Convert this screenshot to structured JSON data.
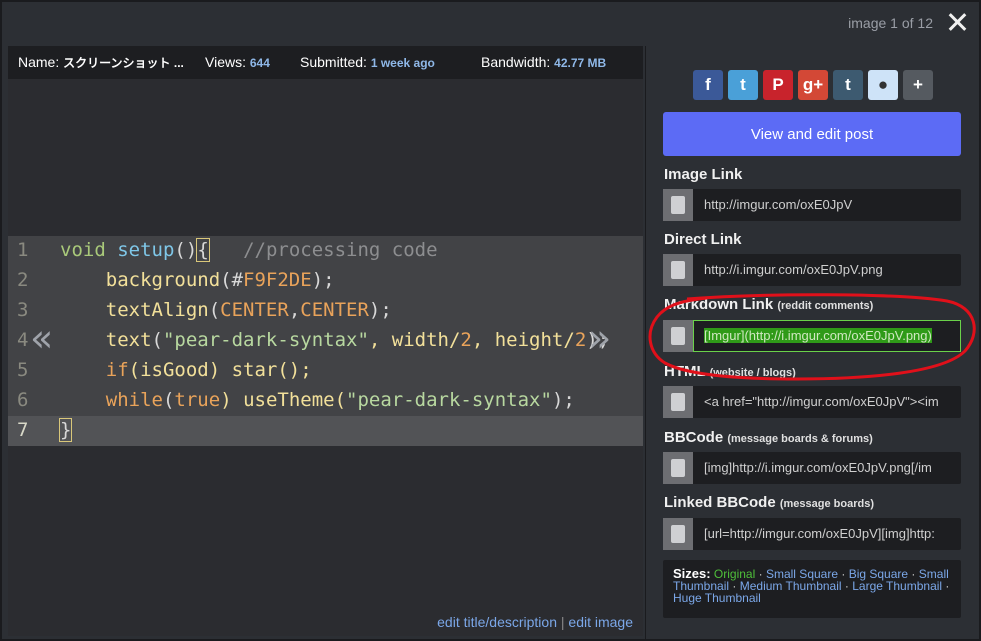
{
  "counter": "image 1 of 12",
  "info": {
    "name_label": "Name:",
    "name_value": "スクリーンショット ...",
    "views_label": "Views:",
    "views_value": "644",
    "submitted_label": "Submitted:",
    "submitted_value": "1 week ago",
    "bandwidth_label": "Bandwidth:",
    "bandwidth_value": "42.77 MB"
  },
  "code_lines": [
    {
      "n": "1"
    },
    {
      "n": "2"
    },
    {
      "n": "3"
    },
    {
      "n": "4"
    },
    {
      "n": "5"
    },
    {
      "n": "6"
    },
    {
      "n": "7"
    }
  ],
  "code": {
    "l1": [
      "void",
      " ",
      "setup",
      "()",
      "{",
      "   ",
      "//processing code"
    ],
    "l2": [
      "    ",
      "background",
      "(#",
      "F9F2DE",
      ");"
    ],
    "l3": [
      "    ",
      "textAlign",
      "(",
      "CENTER",
      ",",
      "CENTER",
      ");"
    ],
    "l4": [
      "    ",
      "text",
      "(",
      "\"pear-dark-syntax\"",
      ", width/",
      "2",
      ", height/",
      "2",
      ");"
    ],
    "l5": [
      "    ",
      "if",
      "(isGood) star();"
    ],
    "l6": [
      "    ",
      "while",
      "(",
      "true",
      ") useTheme(",
      "\"pear-dark-syntax\"",
      ");"
    ],
    "l7": [
      "}"
    ]
  },
  "nav": {
    "prev": "«",
    "next": "»"
  },
  "footer": {
    "edit_title": "edit title/description",
    "sep": "|",
    "edit_image": "edit image"
  },
  "share_icons": [
    {
      "name": "facebook-icon",
      "glyph": "f",
      "color": "#3b5998"
    },
    {
      "name": "twitter-icon",
      "glyph": "t",
      "color": "#4aa0d8"
    },
    {
      "name": "pinterest-icon",
      "glyph": "P",
      "color": "#c8232c"
    },
    {
      "name": "googleplus-icon",
      "glyph": "g+",
      "color": "#d34836"
    },
    {
      "name": "tumblr-icon",
      "glyph": "t",
      "color": "#3d5a70"
    },
    {
      "name": "reddit-icon",
      "glyph": "●",
      "color": "#cee3f8"
    },
    {
      "name": "more-icon",
      "glyph": "+",
      "color": "#555a60"
    }
  ],
  "view_edit_post": "View and edit post",
  "links": {
    "image": {
      "label": "Image Link",
      "sub": "",
      "value": "http://imgur.com/oxE0JpV"
    },
    "direct": {
      "label": "Direct Link",
      "sub": "",
      "value": "http://i.imgur.com/oxE0JpV.png"
    },
    "markdown": {
      "label": "Markdown Link",
      "sub": "(reddit comments)",
      "value": "[Imgur](http://i.imgur.com/oxE0JpV.png)"
    },
    "html": {
      "label": "HTML",
      "sub": "(website / blogs)",
      "value": "<a href=\"http://imgur.com/oxE0JpV\"><im"
    },
    "bbcode": {
      "label": "BBCode",
      "sub": "(message boards & forums)",
      "value": "[img]http://i.imgur.com/oxE0JpV.png[/im"
    },
    "linked_bbcode": {
      "label": "Linked BBCode",
      "sub": "(message boards)",
      "value": "[url=http://imgur.com/oxE0JpV][img]http:"
    }
  },
  "sizes": {
    "heading": "Sizes:",
    "original": "Original",
    "options": [
      "Small Square",
      "Big Square",
      "Small Thumbnail",
      "Medium Thumbnail",
      "Large Thumbnail",
      "Huge Thumbnail"
    ]
  },
  "colors": {
    "accent": "#5c6bf5",
    "annotation": "#e0101a",
    "selected": "#2f9a18"
  }
}
